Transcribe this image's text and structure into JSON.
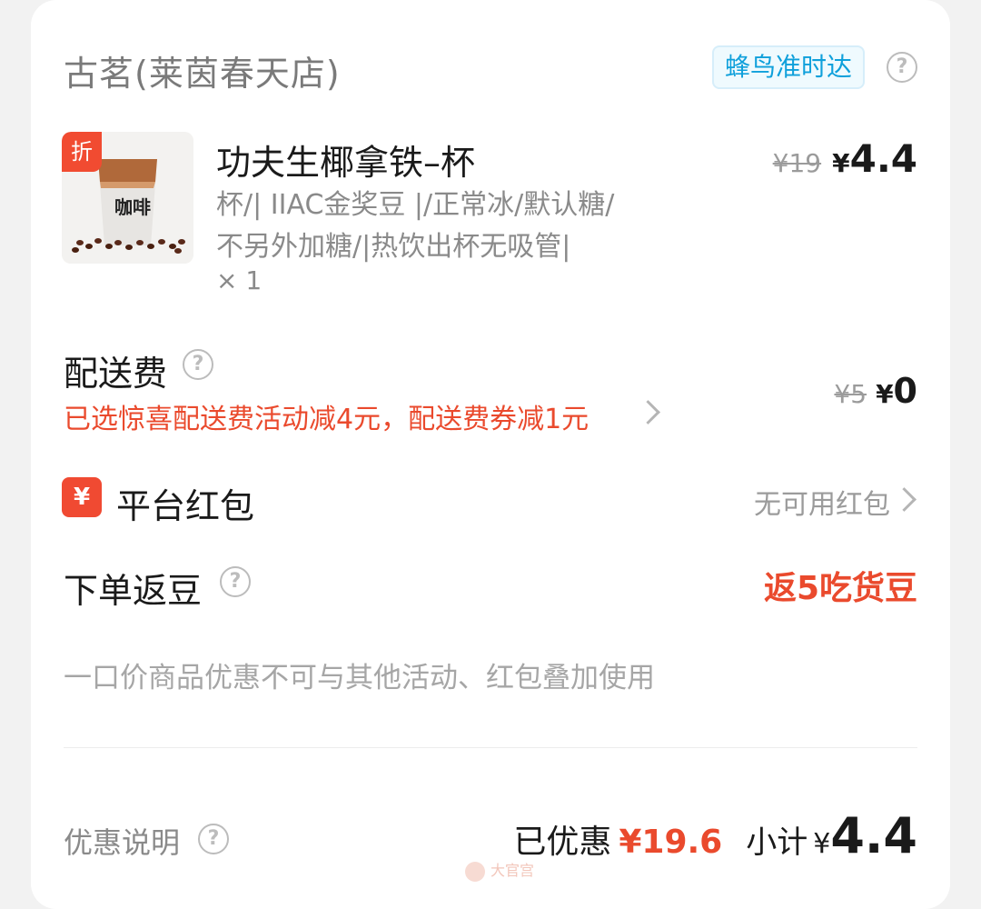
{
  "store": {
    "name": "古茗(莱茵春天店)",
    "delivery_badge": "蜂鸟准时达"
  },
  "product": {
    "discount_tag": "折",
    "image_text": "咖啡",
    "title": "功夫生椰拿铁–杯",
    "spec_line1": "杯/| IIAC金奖豆 |/正常冰/默认糖/",
    "spec_line2": "不另外加糖/|热饮出杯无吸管|",
    "quantity": "× 1",
    "original_price": "¥19",
    "yen": "¥",
    "price": "4.4"
  },
  "delivery_fee": {
    "label": "配送费",
    "promo": "已选惊喜配送费活动减4元，配送费券减1元",
    "original": "¥5",
    "yen": "¥",
    "value": "0"
  },
  "platform_hongbao": {
    "icon_text": "¥",
    "label": "平台红包",
    "status": "无可用红包"
  },
  "order_beans": {
    "label": "下单返豆",
    "value": "返5吃货豆"
  },
  "notice": "一口价商品优惠不可与其他活动、红包叠加使用",
  "footer": {
    "discount_info_label": "优惠说明",
    "saved_label": "已优惠",
    "saved_value": "¥19.6",
    "subtotal_label": "小计",
    "subtotal_yen": "¥",
    "subtotal_value": "4.4"
  },
  "watermark": "大官宫",
  "colors": {
    "accent_red": "#ea4a2d",
    "badge_blue": "#0fa0db",
    "tag_red": "#f14b31"
  },
  "icons": [
    "question-circle-icon",
    "chevron-right-icon",
    "discount-tag",
    "hongbao-icon"
  ]
}
